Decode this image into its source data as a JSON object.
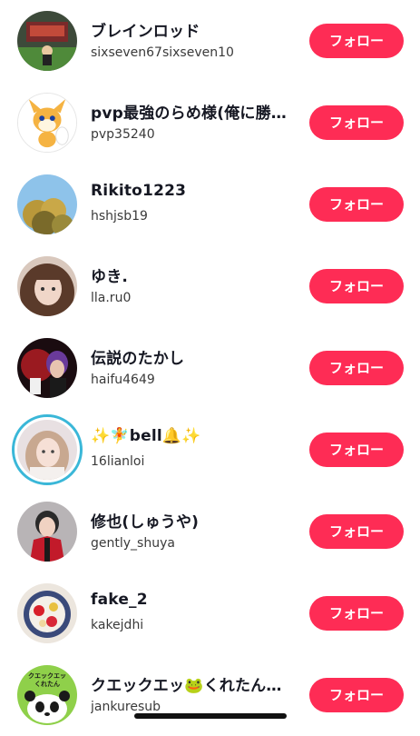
{
  "users": [
    {
      "name": "ブレインロッド",
      "handle": "sixseven67sixseven10",
      "follow_label": "フォロー"
    },
    {
      "name": "pvp最強のらめ様(俺に勝…",
      "handle": "pvp35240",
      "follow_label": "フォロー"
    },
    {
      "name": "Rikito1223",
      "handle": "hshjsb19",
      "follow_label": "フォロー"
    },
    {
      "name": "ゆき.",
      "handle": "lla.ru0",
      "follow_label": "フォロー"
    },
    {
      "name": "伝説のたかし",
      "handle": "haifu4649",
      "follow_label": "フォロー"
    },
    {
      "name": "✨🧚bell🔔✨",
      "handle": "16lianloi",
      "follow_label": "フォロー"
    },
    {
      "name": "修也(しゅうや)",
      "handle": "gently_shuya",
      "follow_label": "フォロー"
    },
    {
      "name": "fake_2",
      "handle": "kakejdhi",
      "follow_label": "フォロー"
    },
    {
      "name": "クエックエッ🐸くれたん…",
      "handle": "jankuresub",
      "follow_label": "フォロー"
    }
  ],
  "avatar_texts": {
    "kuretan_line1": "クエックエッ",
    "kuretan_line2": "くれたん"
  },
  "colors": {
    "follow_button": "#fe2c55",
    "story_ring": "#3ab7d8"
  }
}
